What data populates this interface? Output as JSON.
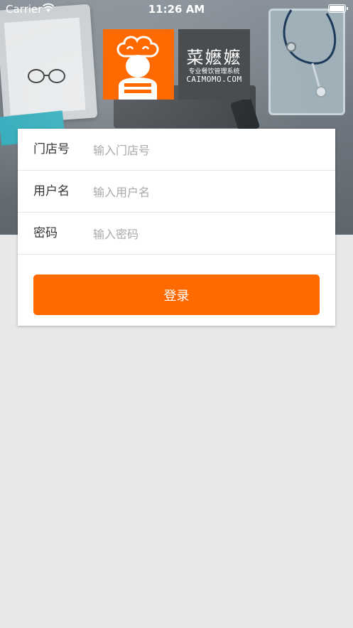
{
  "status_bar": {
    "carrier": "Carrier",
    "time": "11:26 AM"
  },
  "logo": {
    "brand": "菜嬷嬷",
    "slogan": "专业餐饮管理系统",
    "domain": "CAIMOMO.COM",
    "mascot_icon": "chef-mascot-icon",
    "brand_color": "#ff6a00",
    "panel_color": "#4a4d50"
  },
  "form": {
    "store_label": "门店号",
    "store_placeholder": "输入门店号",
    "store_value": "",
    "user_label": "用户名",
    "user_placeholder": "输入用户名",
    "user_value": "",
    "password_label": "密码",
    "password_placeholder": "输入密码",
    "password_value": "",
    "login_label": "登录"
  },
  "colors": {
    "accent": "#ff6a00",
    "background": "#e8e8e8"
  }
}
